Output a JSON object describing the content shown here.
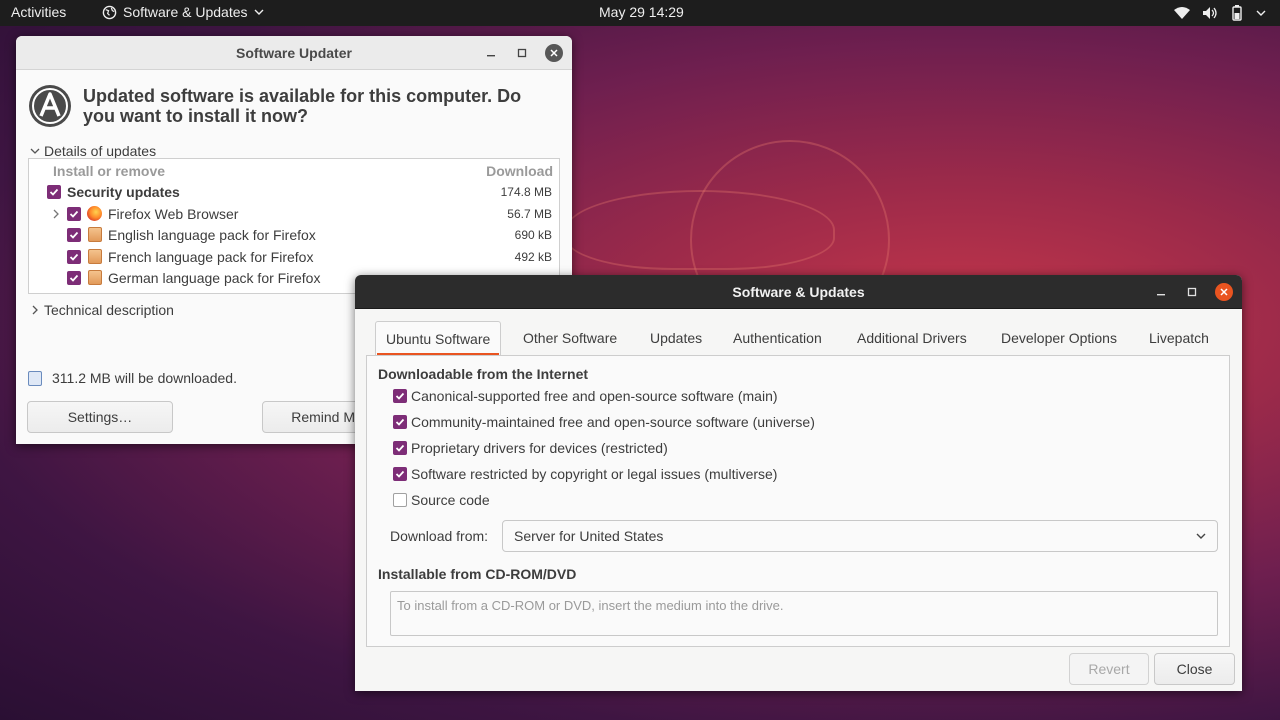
{
  "topbar": {
    "activities": "Activities",
    "app_name": "Software & Updates",
    "clock": "May 29  14:29",
    "tray_icons": [
      "wifi-icon",
      "volume-icon",
      "battery-icon",
      "power-icon"
    ]
  },
  "updater": {
    "title": "Software Updater",
    "heading": "Updated software is available for this computer. Do you want to install it now?",
    "details_label": "Details of updates",
    "columns": {
      "install": "Install or remove",
      "download": "Download"
    },
    "rows": [
      {
        "name": "Security updates",
        "size": "174.8 MB",
        "checked": true,
        "bold": true
      },
      {
        "name": "Firefox Web Browser",
        "size": "56.7 MB",
        "checked": true,
        "icon": "firefox-icon"
      },
      {
        "name": "English language pack for Firefox",
        "size": "690 kB",
        "checked": true,
        "icon": "package-icon"
      },
      {
        "name": "French language pack for Firefox",
        "size": "492 kB",
        "checked": true,
        "icon": "package-icon"
      },
      {
        "name": "German language pack for Firefox",
        "size": "",
        "checked": true,
        "icon": "package-icon"
      }
    ],
    "technical_description": "Technical description",
    "download_summary": "311.2 MB will be downloaded.",
    "settings_button": "Settings…",
    "remind_button": "Remind Me"
  },
  "sw": {
    "title": "Software & Updates",
    "tabs": [
      "Ubuntu Software",
      "Other Software",
      "Updates",
      "Authentication",
      "Additional Drivers",
      "Developer Options",
      "Livepatch"
    ],
    "active_tab": "Ubuntu Software",
    "downloadable_title": "Downloadable from the Internet",
    "options": [
      {
        "label": "Canonical-supported free and open-source software (main)",
        "checked": true
      },
      {
        "label": "Community-maintained free and open-source software (universe)",
        "checked": true
      },
      {
        "label": "Proprietary drivers for devices (restricted)",
        "checked": true
      },
      {
        "label": "Software restricted by copyright or legal issues (multiverse)",
        "checked": true
      },
      {
        "label": "Source code",
        "checked": false
      }
    ],
    "download_from_label": "Download from:",
    "download_from_value": "Server for United States",
    "cdrom_title": "Installable from CD-ROM/DVD",
    "cdrom_placeholder": "To install from a CD-ROM or DVD, insert the medium into the drive.",
    "revert_button": "Revert",
    "close_button": "Close"
  },
  "colors": {
    "accent": "#e95420",
    "checkbox": "#7d2d77",
    "topbar": "#1d1d1d"
  }
}
